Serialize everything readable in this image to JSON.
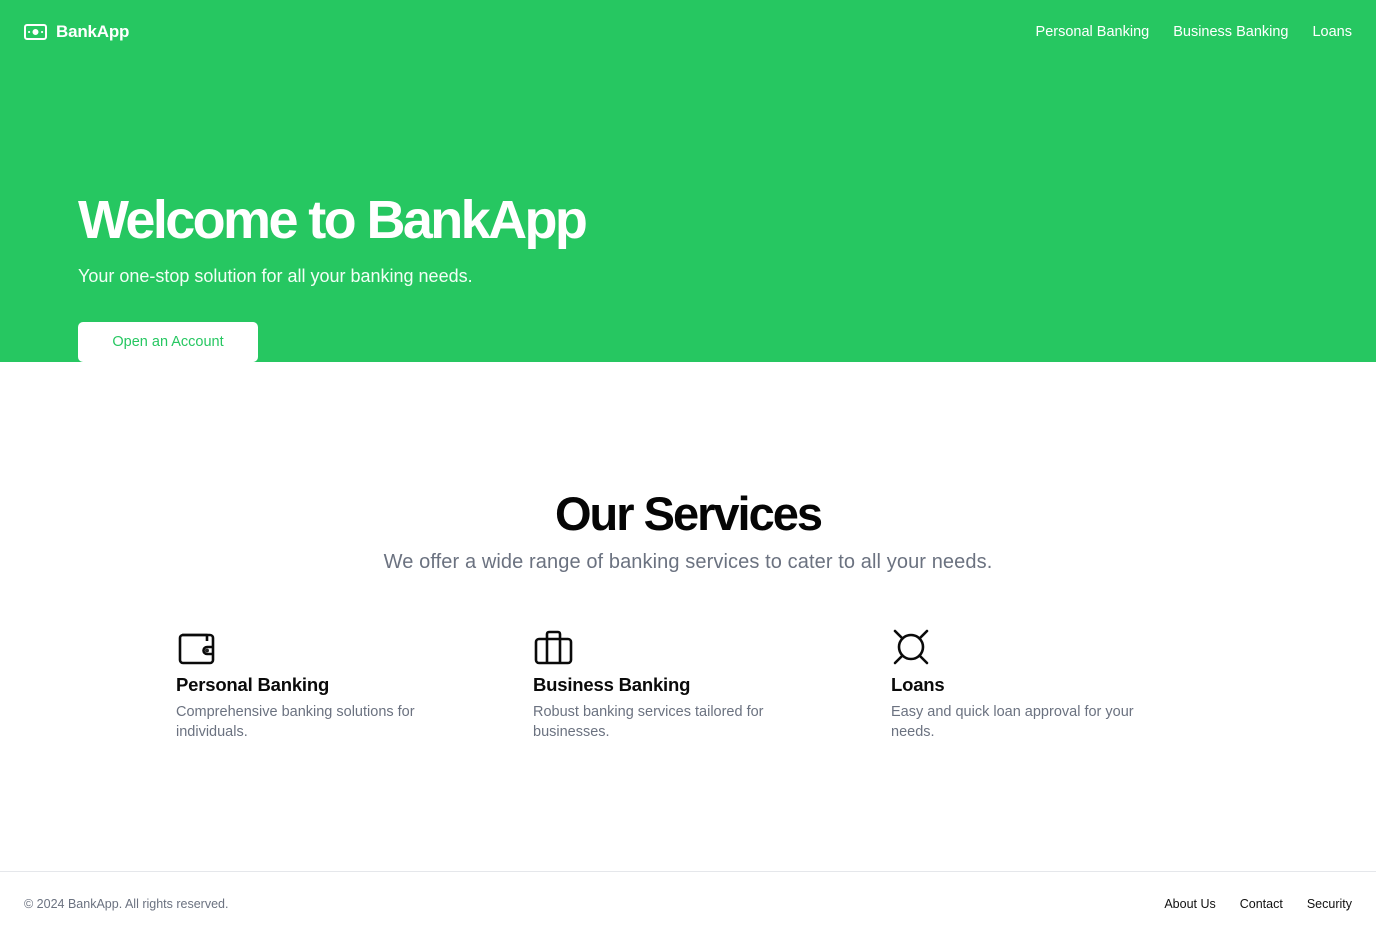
{
  "header": {
    "brand": "BankApp",
    "brand_icon": "banknote-icon",
    "nav": [
      "Personal Banking",
      "Business Banking",
      "Loans"
    ]
  },
  "hero": {
    "title": "Welcome to BankApp",
    "subtitle": "Your one-stop solution for all your banking needs.",
    "cta_label": "Open an Account"
  },
  "services": {
    "title": "Our Services",
    "subtitle": "We offer a wide range of banking services to cater to all your needs.",
    "items": [
      {
        "icon": "wallet-icon",
        "title": "Personal Banking",
        "description": "Comprehensive banking solutions for individuals."
      },
      {
        "icon": "briefcase-icon",
        "title": "Business Banking",
        "description": "Robust banking services tailored for businesses."
      },
      {
        "icon": "currency-icon",
        "title": "Loans",
        "description": "Easy and quick loan approval for your needs."
      }
    ]
  },
  "footer": {
    "copyright": "© 2024 BankApp. All rights reserved.",
    "links": [
      "About Us",
      "Contact",
      "Security"
    ]
  },
  "colors": {
    "brand_green": "#26c761",
    "muted_text": "#6b7280",
    "border": "#e5e7eb"
  }
}
